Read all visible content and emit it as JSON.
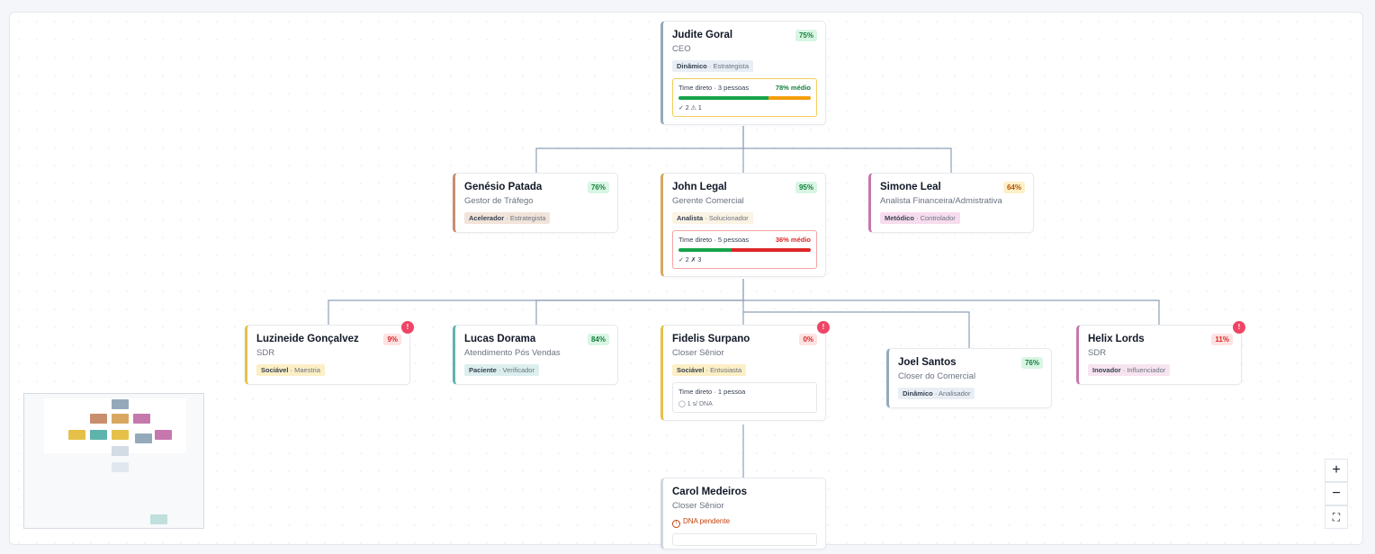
{
  "nodes": {
    "judite": {
      "name": "Judite Goral",
      "role": "CEO",
      "pct": "75%",
      "tag_main": "Dinâmico",
      "tag_sub": "Estrategista",
      "team_label": "Time direto · 3 pessoas",
      "team_avg": "78% médio",
      "team_stats": "✓ 2   ⚠ 1"
    },
    "genesio": {
      "name": "Genésio Patada",
      "role": "Gestor de Tráfego",
      "pct": "76%",
      "tag_main": "Acelerador",
      "tag_sub": "Estrategista"
    },
    "john": {
      "name": "John Legal",
      "role": "Gerente Comercial",
      "pct": "95%",
      "tag_main": "Analista",
      "tag_sub": "Solucionador",
      "team_label": "Time direto · 5 pessoas",
      "team_avg": "36% médio",
      "team_stats": "✓ 2   ✗ 3"
    },
    "simone": {
      "name": "Simone Leal",
      "role": "Analista Financeira/Admistrativa",
      "pct": "64%",
      "tag_main": "Metódico",
      "tag_sub": "Controlador"
    },
    "luzineide": {
      "name": "Luzineide Gonçalvez",
      "role": "SDR",
      "pct": "9%",
      "tag_main": "Sociável",
      "tag_sub": "Maestria"
    },
    "lucas": {
      "name": "Lucas Dorama",
      "role": "Atendimento Pós Vendas",
      "pct": "84%",
      "tag_main": "Paciente",
      "tag_sub": "Verificador"
    },
    "fidelis": {
      "name": "Fidelis Surpano",
      "role": "Closer Sênior",
      "pct": "0%",
      "tag_main": "Sociável",
      "tag_sub": "Entusiasta",
      "team_label": "Time direto · 1 pessoa",
      "team_stats": "◯ 1 s/ DNA"
    },
    "joel": {
      "name": "Joel Santos",
      "role": "Closer do Comercial",
      "pct": "76%",
      "tag_main": "Dinâmico",
      "tag_sub": "Analisador"
    },
    "helix": {
      "name": "Helix Lords",
      "role": "SDR",
      "pct": "11%",
      "tag_main": "Inovador",
      "tag_sub": "Influenciador"
    },
    "carol": {
      "name": "Carol Medeiros",
      "role": "Closer Sênior",
      "pending": "DNA pendente"
    }
  },
  "separator": " · ",
  "alert_glyph": "!",
  "zoom": {
    "in": "+",
    "out": "−",
    "fit": "⛶"
  },
  "colors": {
    "green": "#16a34a",
    "amber": "#f59e0b",
    "red": "#dc2626",
    "ceo": "#94aabb",
    "traffic": "#c88e6e",
    "commercial": "#d8a860",
    "finance": "#c678ad",
    "sdr": "#e6c14a",
    "support": "#5fb3ad"
  },
  "team_progress": {
    "judite": {
      "ok": 0.68,
      "warn": 0.32
    },
    "john": {
      "ok": 0.4,
      "bad": 0.6
    }
  }
}
